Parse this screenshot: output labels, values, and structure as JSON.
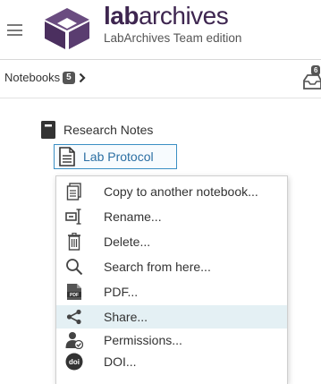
{
  "brand": {
    "name_bold": "lab",
    "name_rest": "archives",
    "edition": "LabArchives Team edition"
  },
  "breadcrumb": {
    "label": "Notebooks",
    "count": "5"
  },
  "inbox": {
    "count": "6"
  },
  "tree": {
    "notebook": "Research Notes",
    "page": "Lab Protocol"
  },
  "menu": {
    "items": [
      {
        "label": "Copy to another notebook...",
        "icon": "copy-icon"
      },
      {
        "label": "Rename...",
        "icon": "rename-icon"
      },
      {
        "label": "Delete...",
        "icon": "trash-icon"
      },
      {
        "label": "Search from here...",
        "icon": "search-icon"
      },
      {
        "label": "PDF...",
        "icon": "pdf-icon"
      },
      {
        "label": "Share...",
        "icon": "share-icon",
        "highlighted": true
      },
      {
        "label": "Permissions...",
        "icon": "permissions-icon"
      },
      {
        "label": "DOI...",
        "icon": "doi-icon"
      }
    ]
  },
  "colors": {
    "brand_purple": "#3e2650",
    "accent_blue": "#3b8fc4",
    "highlight": "#e4f0f4"
  }
}
